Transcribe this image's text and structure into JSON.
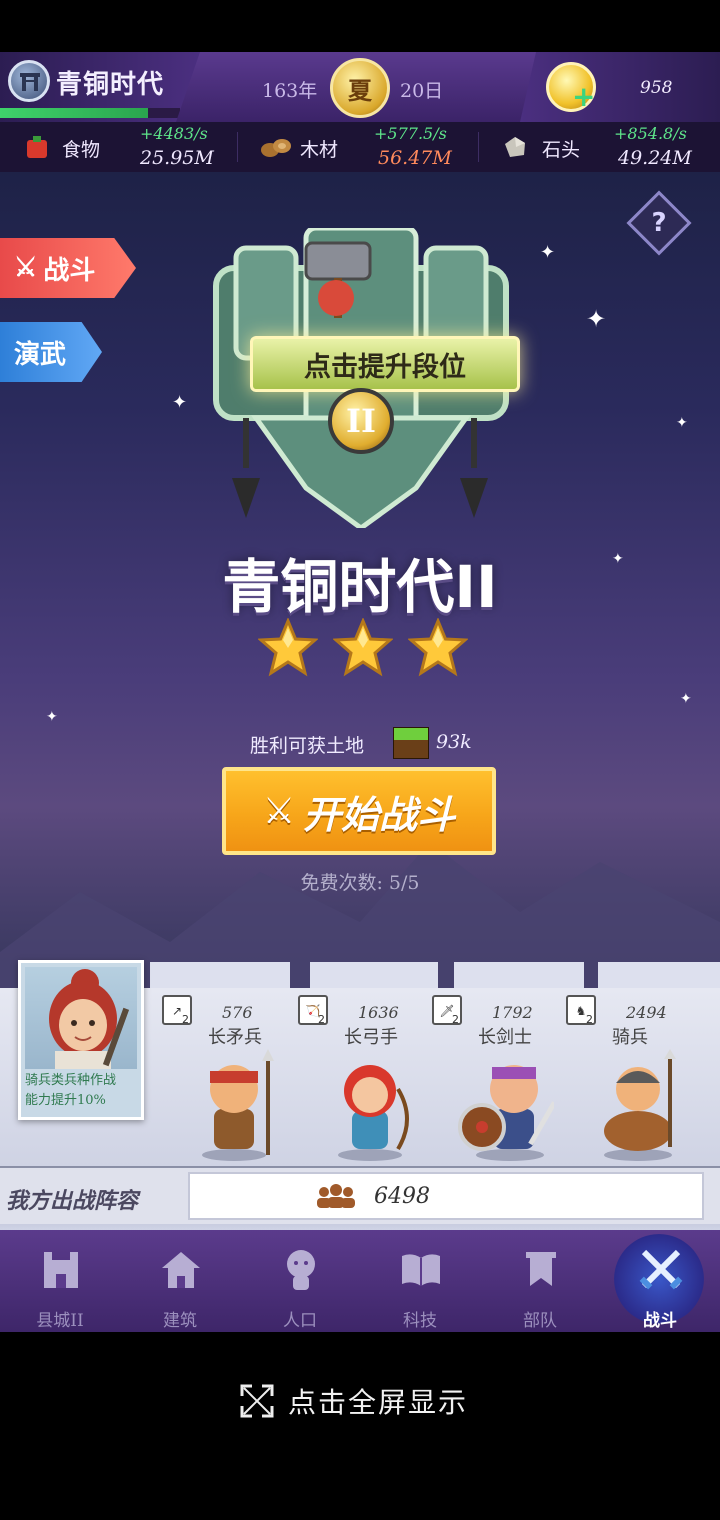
{
  "top_bar": {
    "era_title": "青铜时代",
    "era_progress": 0.82,
    "year": "163年",
    "season": "夏",
    "day": "20日",
    "gems": "958"
  },
  "resources": [
    {
      "name": "食物",
      "rate": "+4483/s",
      "total": "25.95M",
      "icon": "food-icon",
      "total_color": "#f0e8ff"
    },
    {
      "name": "木材",
      "rate": "+577.5/s",
      "total": "56.47M",
      "icon": "wood-icon",
      "total_color": "#ff8a5c"
    },
    {
      "name": "石头",
      "rate": "+854.8/s",
      "total": "49.24M",
      "icon": "stone-icon",
      "total_color": "#f0e8ff"
    }
  ],
  "side_tabs": {
    "battle": "战斗",
    "drill": "演武"
  },
  "help": "?",
  "emblem": {
    "upgrade_label": "点击提升段位",
    "rank": "II"
  },
  "era_heading": "青铜时代II",
  "stars": 3,
  "reward": {
    "label": "胜利可获土地",
    "amount": "93k"
  },
  "start_button": "开始战斗",
  "free_count": "免费次数: 5/5",
  "general": {
    "bonus_line1": "骑兵类兵种作战",
    "bonus_line2": "能力提升10%"
  },
  "units": [
    {
      "count": "576",
      "name": "长矛兵",
      "rank": "2"
    },
    {
      "count": "1636",
      "name": "长弓手",
      "rank": "2"
    },
    {
      "count": "1792",
      "name": "长剑士",
      "rank": "2"
    },
    {
      "count": "2494",
      "name": "骑兵",
      "rank": "2"
    }
  ],
  "lineup": {
    "label": "我方出战阵容",
    "power": "6498"
  },
  "nav": [
    {
      "label": "县城II",
      "icon": "castle-icon"
    },
    {
      "label": "建筑",
      "icon": "house-icon"
    },
    {
      "label": "人口",
      "icon": "person-icon"
    },
    {
      "label": "科技",
      "icon": "book-icon"
    },
    {
      "label": "部队",
      "icon": "banner-icon"
    },
    {
      "label": "战斗",
      "icon": "crossed-swords-icon"
    }
  ],
  "fullscreen_hint": "点击全屏显示",
  "colors": {
    "accent_purple": "#4b2f80",
    "start_button": "#f7a61a",
    "battle_tab": "#e84a4a",
    "drill_tab": "#2e7fd8",
    "rate_green": "#5ee58a"
  }
}
